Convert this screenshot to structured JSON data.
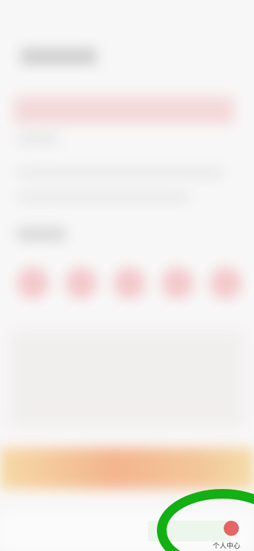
{
  "tab_bar": {
    "profile_label": "个人中心",
    "profile_icon": "profile-icon"
  },
  "colors": {
    "annotation": "#12b012",
    "accent": "#e24a4a"
  }
}
